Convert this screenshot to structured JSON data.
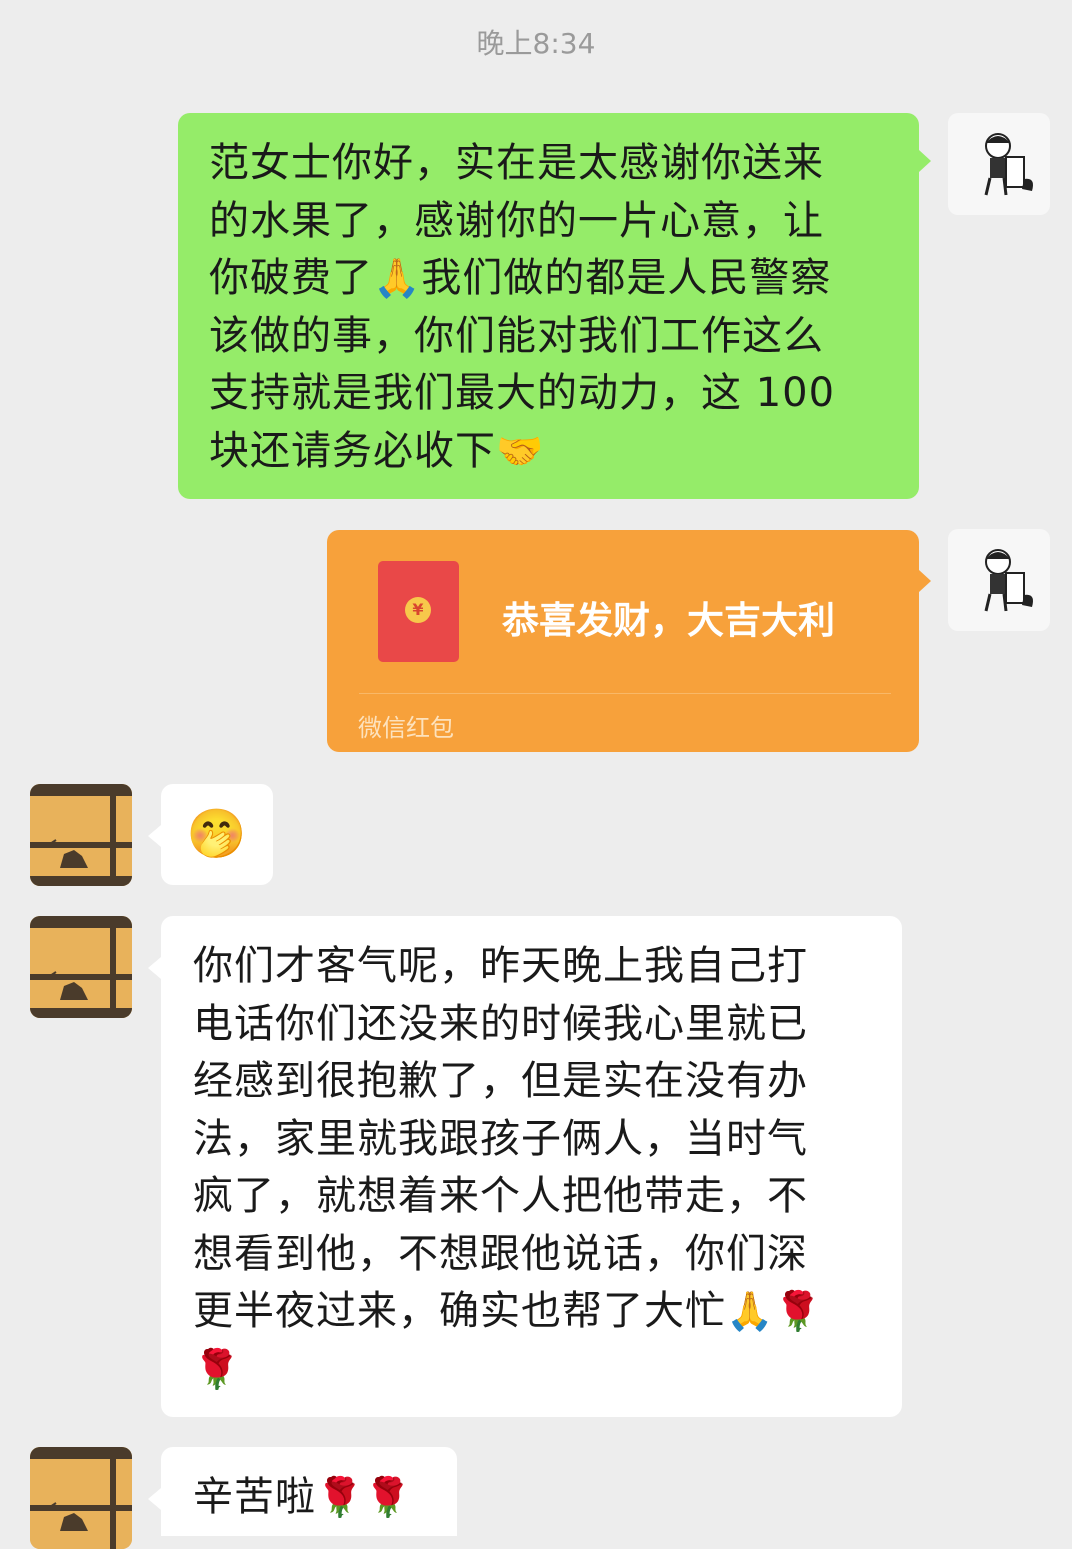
{
  "timestamp": "晚上8:34",
  "messages": {
    "m1": {
      "lines": [
        "范女士你好，实在是太感谢你送来",
        "的水果了，感谢你的一片心意，让",
        "你破费了",
        "我们做的都是人民警察",
        "该做的事，你们能对我们工作这么",
        "支持就是我们最大的动力，这 100",
        "块还请务必收下"
      ],
      "emoji_pray": "🙏",
      "emoji_handshake": "🤝"
    },
    "red_packet": {
      "title": "恭喜发财，大吉大利",
      "coin": "¥",
      "footer": "微信红包"
    },
    "m3": {
      "emoji": "🤭"
    },
    "m4": {
      "lines": [
        "你们才客气呢，昨天晚上我自己打",
        "电话你们还没来的时候我心里就已",
        "经感到很抱歉了，但是实在没有办",
        "法，家里就我跟孩子俩人，当时气",
        "疯了，就想着来个人把他带走，不",
        "想看到他，不想跟他说话，你们深",
        "更半夜过来，确实也帮了大忙"
      ],
      "emoji_pray": "🙏",
      "emoji_rose1": "🌹",
      "emoji_rose2": "🌹"
    },
    "m5": {
      "text": "辛苦啦",
      "emoji_rose1": "🌹",
      "emoji_rose2": "🌹"
    }
  },
  "colors": {
    "background": "#ededed",
    "sent_bubble": "#95ec69",
    "received_bubble": "#ffffff",
    "red_packet": "#f7a13b"
  }
}
